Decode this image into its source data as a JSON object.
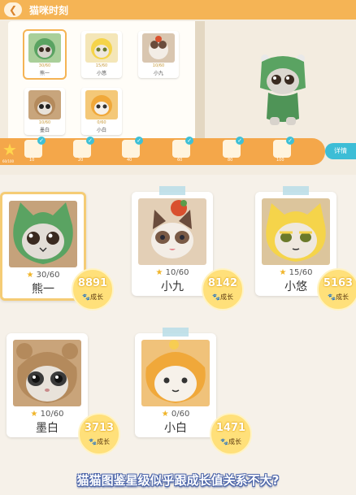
{
  "game": {
    "title": "猫咪时刻",
    "back_icon": "chevron-left-icon",
    "album": [
      {
        "name": "熊一",
        "stars": "30/60"
      },
      {
        "name": "小悠",
        "stars": "15/60"
      },
      {
        "name": "小九",
        "stars": "10/60"
      },
      {
        "name": "墨白",
        "stars": "10/60"
      },
      {
        "name": "小白",
        "stars": "0/60"
      }
    ],
    "strip_count": "60/100",
    "strip_values": [
      "10",
      "20",
      "40",
      "60",
      "80",
      "100"
    ],
    "detail_button": "详情"
  },
  "cards": [
    {
      "name": "熊一",
      "rating": "30/60",
      "growth": "8891",
      "growth_label": "成长",
      "color": "#5aa362"
    },
    {
      "name": "小九",
      "rating": "10/60",
      "growth": "8142",
      "growth_label": "成长",
      "color": "#f3e6d6"
    },
    {
      "name": "小悠",
      "rating": "15/60",
      "growth": "5163",
      "growth_label": "成长",
      "color": "#f5d44a"
    },
    {
      "name": "墨白",
      "rating": "10/60",
      "growth": "3713",
      "growth_label": "成长",
      "color": "#b48a5c"
    },
    {
      "name": "小白",
      "rating": "0/60",
      "growth": "1471",
      "growth_label": "成长",
      "color": "#f0a83a"
    }
  ],
  "caption": "猫猫图鉴星级似乎跟成长值关系不大?"
}
